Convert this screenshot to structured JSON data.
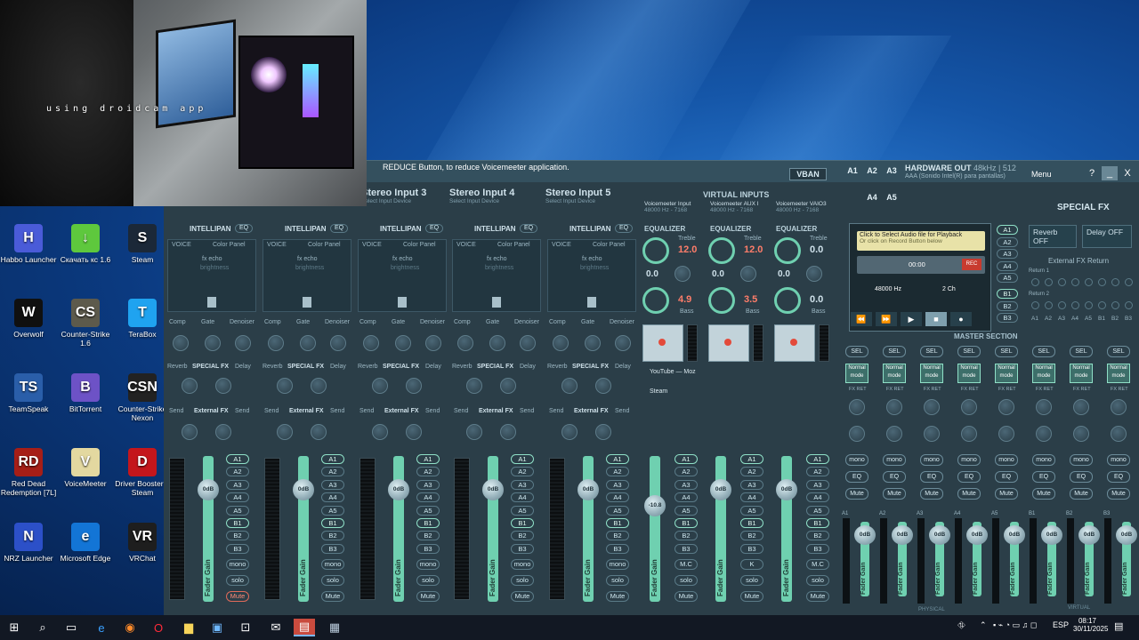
{
  "webcam": {
    "watermark": "using droidcam app"
  },
  "desktop": {
    "icons": [
      {
        "label": "Habbo Launcher",
        "glyph": "H",
        "color": "#4a5bd8"
      },
      {
        "label": "Скачать кс 1.6",
        "glyph": "↓",
        "color": "#5ec83d"
      },
      {
        "label": "Steam",
        "glyph": "S",
        "color": "#1b2838"
      },
      {
        "label": "Overwolf",
        "glyph": "W",
        "color": "#101010"
      },
      {
        "label": "Counter-Strike 1.6",
        "glyph": "CS",
        "color": "#5d5a4c"
      },
      {
        "label": "TeraBox",
        "glyph": "T",
        "color": "#1fa3f0"
      },
      {
        "label": "TeamSpeak",
        "glyph": "TS",
        "color": "#2a5ea9"
      },
      {
        "label": "BitTorrent",
        "glyph": "B",
        "color": "#6d52c6"
      },
      {
        "label": "Counter-Strike Nexon",
        "glyph": "CSN",
        "color": "#222"
      },
      {
        "label": "Red Dead Redemption [7L]",
        "glyph": "RD",
        "color": "#a61e17"
      },
      {
        "label": "VoiceMeeter",
        "glyph": "V",
        "color": "#e3d8a0"
      },
      {
        "label": "Driver Booster 9 Steam",
        "glyph": "D",
        "color": "#c4161c"
      },
      {
        "label": "NRZ Launcher",
        "glyph": "N",
        "color": "#2c50c8"
      },
      {
        "label": "Microsoft Edge",
        "glyph": "e",
        "color": "#1375d6"
      },
      {
        "label": "VRChat",
        "glyph": "VR",
        "color": "#1e1e1e"
      }
    ]
  },
  "voicemeeter": {
    "tooltip": "REDUCE Button, to reduce Voicemeeter application.",
    "vban": "VBAN",
    "hw_buttons_top": [
      "A1",
      "A2",
      "A3"
    ],
    "hw_buttons_bottom": [
      "A4",
      "A5"
    ],
    "hw_title": "HARDWARE OUT",
    "hw_rate": "48kHz | 512",
    "hw_device": "AAA (Sonido Intel(R) para pantallas)",
    "menu": "Menu",
    "help": "?",
    "close": "X",
    "strips": [
      {
        "title": "Stereo Input 3",
        "sub": "Select Input Device"
      },
      {
        "title": "Stereo Input 4",
        "sub": "Select Input Device"
      },
      {
        "title": "Stereo Input 5",
        "sub": "Select Input Device"
      }
    ],
    "intellipan": "INTELLIPAN",
    "eq": "EQ",
    "voice": "VOICE",
    "color_panel": "Color Panel",
    "fx_echo": "fx echo",
    "brightness": "brightness",
    "comp": "Comp",
    "gate": "Gate",
    "denoiser": "Denoiser",
    "reverb": "Reverb",
    "special_fx": "SPECIAL FX",
    "delay": "Delay",
    "send": "Send",
    "external_fx": "External FX",
    "fader_gain": "Fader Gain",
    "db0": "0dB",
    "db_neg": "-10.8",
    "bus_labels": [
      "A1",
      "A2",
      "A3",
      "A4",
      "A5",
      "B1",
      "B2",
      "B3"
    ],
    "mono": "mono",
    "solo": "solo",
    "mute": "Mute",
    "mc": "M.C",
    "k": "K",
    "equalizer": "EQUALIZER",
    "virtual_inputs": "VIRTUAL INPUTS",
    "virt": [
      {
        "title": "Voicemeeter Input",
        "sub": "48000 Hz - 7168"
      },
      {
        "title": "Voicemeeter AUX I",
        "sub": "48000 Hz - 7168"
      },
      {
        "title": "Voicemeeter VAIO3",
        "sub": "48000 Hz - 7168"
      }
    ],
    "treble": "Treble",
    "bass": "Bass",
    "v1_treble": "12.0",
    "v1_bass": "4.9",
    "v2_treble": "12.0",
    "v2_bass": "3.5",
    "v3_treble": "0.0",
    "v3_bass": "0.0",
    "zero": "0.0",
    "apps": [
      "YouTube — Moz",
      "Steam"
    ],
    "tape": {
      "line1": "Click to Select Audio file for Playback",
      "line2": "Or click on Record Button below",
      "time": "00:00",
      "rate": "48000 Hz",
      "ch": "2 Ch",
      "rec": "REC"
    },
    "tape_buttons": [
      "⏪",
      "⏩",
      "▶",
      "■",
      "●"
    ],
    "special_fx_title": "SPECIAL FX",
    "reverb_off": "Reverb OFF",
    "delay_off": "Delay OFF",
    "ext_fx_return": "External FX Return",
    "return1": "Return 1",
    "return2": "Return 2",
    "fx_buses": [
      "A1",
      "A2",
      "A3",
      "A4",
      "A5",
      "B1",
      "B2",
      "B3"
    ],
    "master_section": "MASTER SECTION",
    "sel": "SEL",
    "normal_mode": "Normal mode",
    "fx_ret": "FX RET",
    "mastermono": "mono",
    "mastereq": "EQ",
    "mastermute": "Mute",
    "physical": "PHYSICAL",
    "virtual": "VIRTUAL",
    "master_labels": [
      "A1",
      "A2",
      "A3",
      "A4",
      "A5",
      "B1",
      "B2",
      "B3"
    ]
  },
  "taskbar": {
    "lang": "ESP",
    "time": "08:17",
    "date": "30/11/2025"
  }
}
